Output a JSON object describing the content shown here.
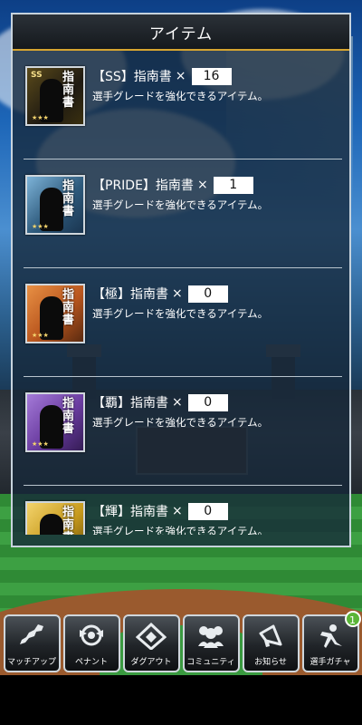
{
  "panel": {
    "title": "アイテム"
  },
  "items": [
    {
      "name": "【SS】指南書",
      "times": "×",
      "qty": "16",
      "desc": "選手グレードを強化できるアイテム。",
      "card_tag": "SS",
      "card_kanji": "指南書",
      "card_color": "#1f1a12"
    },
    {
      "name": "【PRIDE】指南書",
      "times": "×",
      "qty": "1",
      "desc": "選手グレードを強化できるアイテム。",
      "card_tag": "",
      "card_kanji": "指南書",
      "card_color": "#2e5a7c"
    },
    {
      "name": "【極】指南書",
      "times": "×",
      "qty": "0",
      "desc": "選手グレードを強化できるアイテム。",
      "card_tag": "",
      "card_kanji": "指南書",
      "card_color": "#b9561e"
    },
    {
      "name": "【覇】指南書",
      "times": "×",
      "qty": "0",
      "desc": "選手グレードを強化できるアイテム。",
      "card_tag": "",
      "card_kanji": "指南書",
      "card_color": "#6a3ca0"
    },
    {
      "name": "【輝】指南書",
      "times": "×",
      "qty": "0",
      "desc": "選手グレードを強化できるアイテム。",
      "card_tag": "",
      "card_kanji": "指南書",
      "card_color": "#c79a1c"
    }
  ],
  "nav": [
    {
      "label": "マッチアップ",
      "icon": "japan-map-icon"
    },
    {
      "label": "ペナント",
      "icon": "pennant-emblem-icon"
    },
    {
      "label": "ダグアウト",
      "icon": "baseball-diamond-icon"
    },
    {
      "label": "コミュニティ",
      "icon": "people-group-icon"
    },
    {
      "label": "お知らせ",
      "icon": "megaphone-icon"
    },
    {
      "label": "選手ガチャ",
      "icon": "pitcher-icon",
      "badge": "1"
    }
  ],
  "colors": {
    "accent_gold": "#d7a531",
    "badge_green": "#5ab538"
  }
}
